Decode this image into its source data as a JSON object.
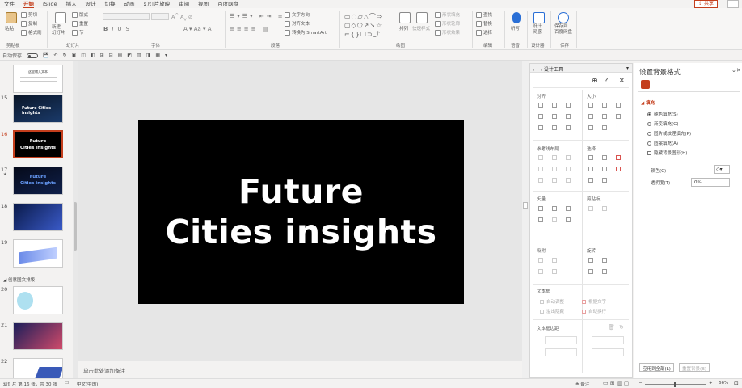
{
  "menu": {
    "items": [
      "文件",
      "开始",
      "iSlide",
      "插入",
      "设计",
      "切换",
      "动画",
      "幻灯片放映",
      "审阅",
      "视图",
      "百度网盘"
    ],
    "active": "开始",
    "share": "共享"
  },
  "ribbon": {
    "paste": "粘贴",
    "cut": "剪切",
    "copy": "复制",
    "format_painter": "格式刷",
    "clipboard_label": "剪贴板",
    "new_slide": "新建\n幻灯片",
    "layout": "版式",
    "reset": "重置",
    "section": "节",
    "slides_label": "幻灯片",
    "font_label": "字体",
    "text_direction": "文字方向",
    "align_text": "对齐文本",
    "smartart": "转换为 SmartArt",
    "paragraph_label": "段落",
    "arrange": "排列",
    "quick_styles": "快速样式",
    "shape_fill": "形状填充",
    "shape_outline": "形状轮廓",
    "shape_effect": "形状效果",
    "drawing_label": "绘图",
    "find": "查找",
    "replace": "替换",
    "select": "选择",
    "editing_label": "编辑",
    "dictate": "听写",
    "voice_label": "语音",
    "designer": "设计\n灵感",
    "designer_label": "设计器",
    "save_baidu": "保存到\n百度网盘",
    "save_label": "保存"
  },
  "qat": {
    "autosave": "自动保存"
  },
  "thumbnails": [
    {
      "num": "",
      "text": "这里输入文本",
      "bg": "#ffffff",
      "fg": "#333333"
    },
    {
      "num": "15",
      "text": "Future Cities insights",
      "bg": "#0a1628",
      "fg": "#ffffff"
    },
    {
      "num": "16",
      "text": "Future\nCities insights",
      "bg": "#000000",
      "fg": "#ffffff",
      "selected": true
    },
    {
      "num": "17",
      "text": "Future\nCities insights",
      "bg": "#0a1430",
      "fg": "#6aa0ff"
    },
    {
      "num": "18",
      "text": "",
      "bg": "#1a2a6a",
      "fg": "#ffffff"
    },
    {
      "num": "19",
      "text": "",
      "bg": "#ffffff",
      "fg": "#333333"
    },
    {
      "num": "20",
      "text": "",
      "bg": "#ffffff",
      "fg": "#333333"
    },
    {
      "num": "21",
      "text": "",
      "bg": "#2a2e6a",
      "fg": "#ffffff"
    },
    {
      "num": "22",
      "text": "",
      "bg": "#ffffff",
      "fg": "#333333"
    }
  ],
  "section_title": "创意图文排版",
  "slide": {
    "line1": "Future",
    "line2": "Cities insights"
  },
  "notes_placeholder": "单击此处添加备注",
  "design_panel": {
    "title": "设计工具",
    "align": "对齐",
    "size": "大小",
    "guides": "参考线布局",
    "select": "选择",
    "vector": "矢量",
    "clipboard": "剪贴板",
    "snap": "吸附",
    "rotate": "旋转",
    "textbox": "文本框",
    "auto_adjust": "自动调整",
    "wrap_text": "根据文字",
    "overflow_hide": "溢出隐藏",
    "auto_wrap": "自动换行",
    "textbox_margin": "文本框边距"
  },
  "format_pane": {
    "title": "设置背景格式",
    "fill": "填充",
    "solid": "纯色填充(S)",
    "gradient": "渐变填充(G)",
    "picture": "图片或纹理填充(P)",
    "pattern": "图案填充(A)",
    "hide_bg": "隐藏背景图形(H)",
    "color": "颜色(C)",
    "transparency": "透明度(T)",
    "transparency_value": "0%",
    "apply_all": "应用到全部(L)",
    "reset_bg": "重置背景(B)"
  },
  "status": {
    "slide_info": "幻灯片 第 16 张，共 30 张",
    "language": "中文(中国)",
    "notes": "备注",
    "zoom": "66%"
  }
}
